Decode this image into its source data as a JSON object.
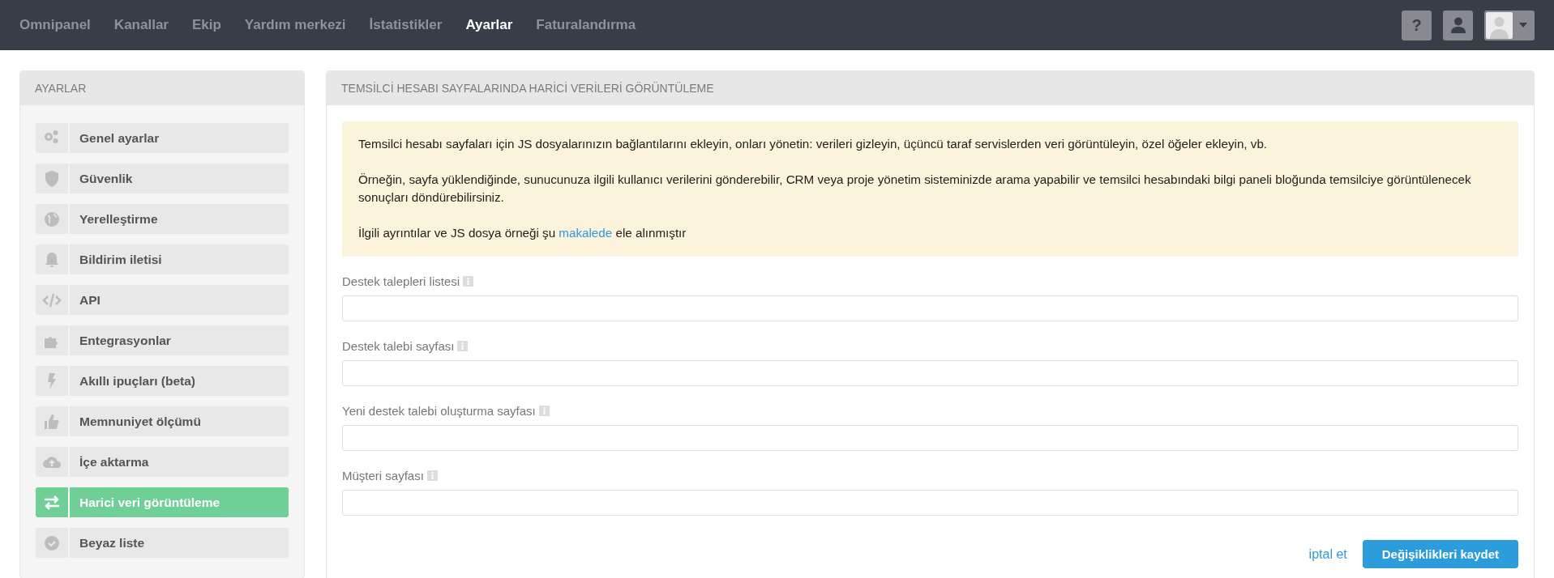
{
  "nav": {
    "items": [
      {
        "label": "Omnipanel",
        "selected": false
      },
      {
        "label": "Kanallar",
        "selected": false
      },
      {
        "label": "Ekip",
        "selected": false
      },
      {
        "label": "Yardım merkezi",
        "selected": false
      },
      {
        "label": "İstatistikler",
        "selected": false
      },
      {
        "label": "Ayarlar",
        "selected": true
      },
      {
        "label": "Faturalandırma",
        "selected": false
      }
    ],
    "help_button": "?"
  },
  "sidebar": {
    "title": "AYARLAR",
    "items": [
      {
        "label": "Genel ayarlar",
        "selected": false
      },
      {
        "label": "Güvenlik",
        "selected": false
      },
      {
        "label": "Yerelleştirme",
        "selected": false
      },
      {
        "label": "Bildirim iletisi",
        "selected": false
      },
      {
        "label": "API",
        "selected": false
      },
      {
        "label": "Entegrasyonlar",
        "selected": false
      },
      {
        "label": "Akıllı ipuçları (beta)",
        "selected": false
      },
      {
        "label": "Memnuniyet ölçümü",
        "selected": false
      },
      {
        "label": "İçe aktarma",
        "selected": false
      },
      {
        "label": "Harici veri görüntüleme",
        "selected": true
      },
      {
        "label": "Beyaz liste",
        "selected": false
      }
    ]
  },
  "panel": {
    "title": "TEMSİLCİ HESABI SAYFALARINDA HARİCİ VERİLERİ GÖRÜNTÜLEME",
    "info": {
      "paragraphs": [
        "Temsilci hesabı sayfaları için JS dosyalarınızın bağlantılarını ekleyin, onları yönetin: verileri gizleyin, üçüncü taraf servislerden veri görüntüleyin, özel öğeler ekleyin, vb.",
        "Örneğin, sayfa yüklendiğinde, sunucunuza ilgili kullanıcı verilerini gönderebilir, CRM veya proje yönetim sisteminizde arama yapabilir ve temsilci hesabındaki bilgi paneli bloğunda temsilciye görüntülenecek sonuçları döndürebilirsiniz."
      ],
      "note": {
        "before": "İlgili ayrıntılar ve JS dosya örneği şu",
        "link": "makalede",
        "after": "ele alınmıştır"
      }
    },
    "fields": [
      {
        "label": "Destek talepleri listesi"
      },
      {
        "label": "Destek talebi sayfası"
      },
      {
        "label": "Yeni destek talebi oluşturma sayfası"
      },
      {
        "label": "Müşteri sayfası"
      }
    ],
    "cancel": "iptal et",
    "save": "Değişiklikleri kaydet"
  }
}
